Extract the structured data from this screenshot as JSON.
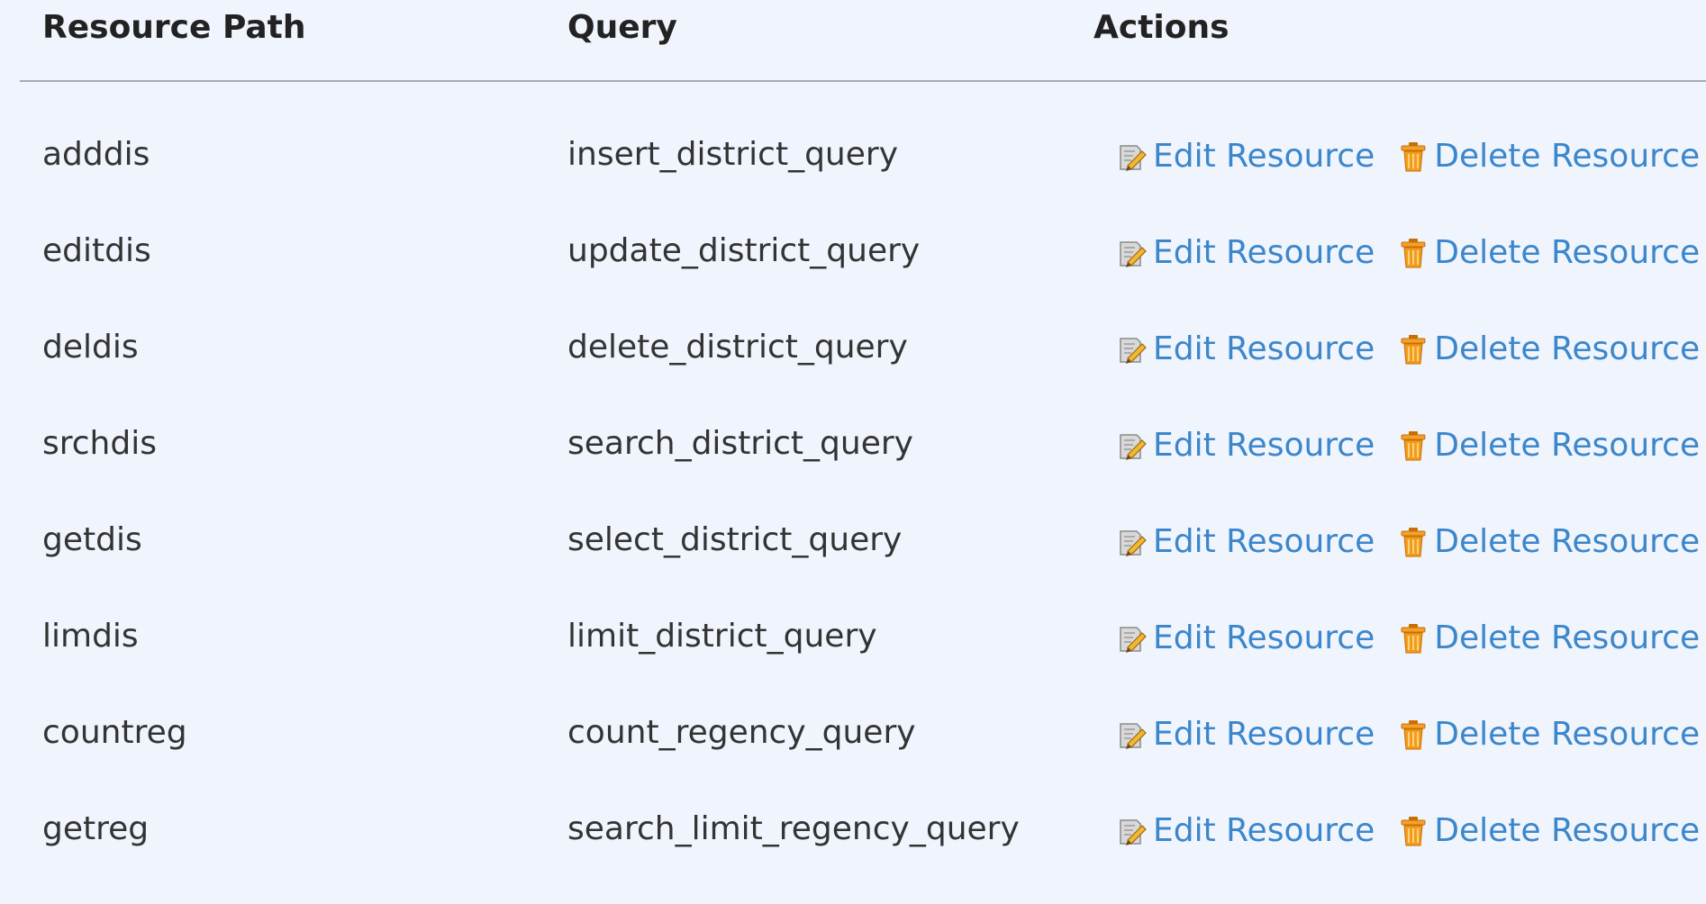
{
  "header": {
    "resource_path": "Resource Path",
    "query": "Query",
    "actions": "Actions"
  },
  "rows": [
    {
      "path": "adddis",
      "query": "insert_district_query"
    },
    {
      "path": "editdis",
      "query": "update_district_query"
    },
    {
      "path": "deldis",
      "query": "delete_district_query"
    },
    {
      "path": "srchdis",
      "query": "search_district_query"
    },
    {
      "path": "getdis",
      "query": "select_district_query"
    },
    {
      "path": "limdis",
      "query": "limit_district_query"
    },
    {
      "path": "countreg",
      "query": "count_regency_query"
    },
    {
      "path": "getreg",
      "query": "search_limit_regency_query"
    }
  ],
  "actions": {
    "edit_label": "Edit Resource",
    "delete_label": "Delete Resource",
    "edit_icon": "pencil-edit-icon",
    "delete_icon": "trash-icon"
  },
  "colors": {
    "background": "#eff4fd",
    "link": "#3c86cb",
    "trash": "#e8930f"
  }
}
